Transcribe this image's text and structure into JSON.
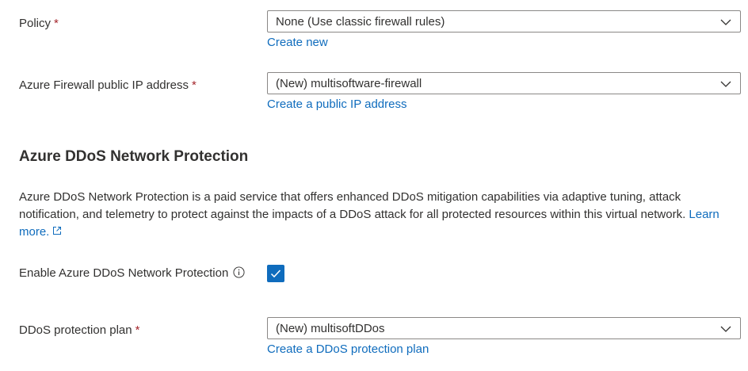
{
  "policy": {
    "label": "Policy",
    "required_mark": "*",
    "value": "None (Use classic firewall rules)",
    "link": "Create new"
  },
  "firewall_ip": {
    "label": "Azure Firewall public IP address",
    "required_mark": "*",
    "value": "(New) multisoftware-firewall",
    "link": "Create a public IP address"
  },
  "ddos_section": {
    "title": "Azure DDoS Network Protection",
    "description": "Azure DDoS Network Protection is a paid service that offers enhanced DDoS mitigation capabilities via adaptive tuning, attack notification, and telemetry to protect against the impacts of a DDoS attack for all protected resources within this virtual network.",
    "learn_more": "Learn more.",
    "enable_label": "Enable Azure DDoS Network Protection",
    "enable_checked": true
  },
  "ddos_plan": {
    "label": "DDoS protection plan",
    "required_mark": "*",
    "value": "(New) multisoftDDos",
    "link": "Create a DDoS protection plan"
  },
  "icons": {
    "dropdown": "chevron-down-icon",
    "external": "external-link-icon",
    "info": "info-icon",
    "check": "checkmark-icon"
  },
  "colors": {
    "link": "#0f6cbd",
    "required": "#a4262c",
    "checkbox": "#0f6cbd",
    "text": "#323130",
    "border": "#8a8886"
  }
}
